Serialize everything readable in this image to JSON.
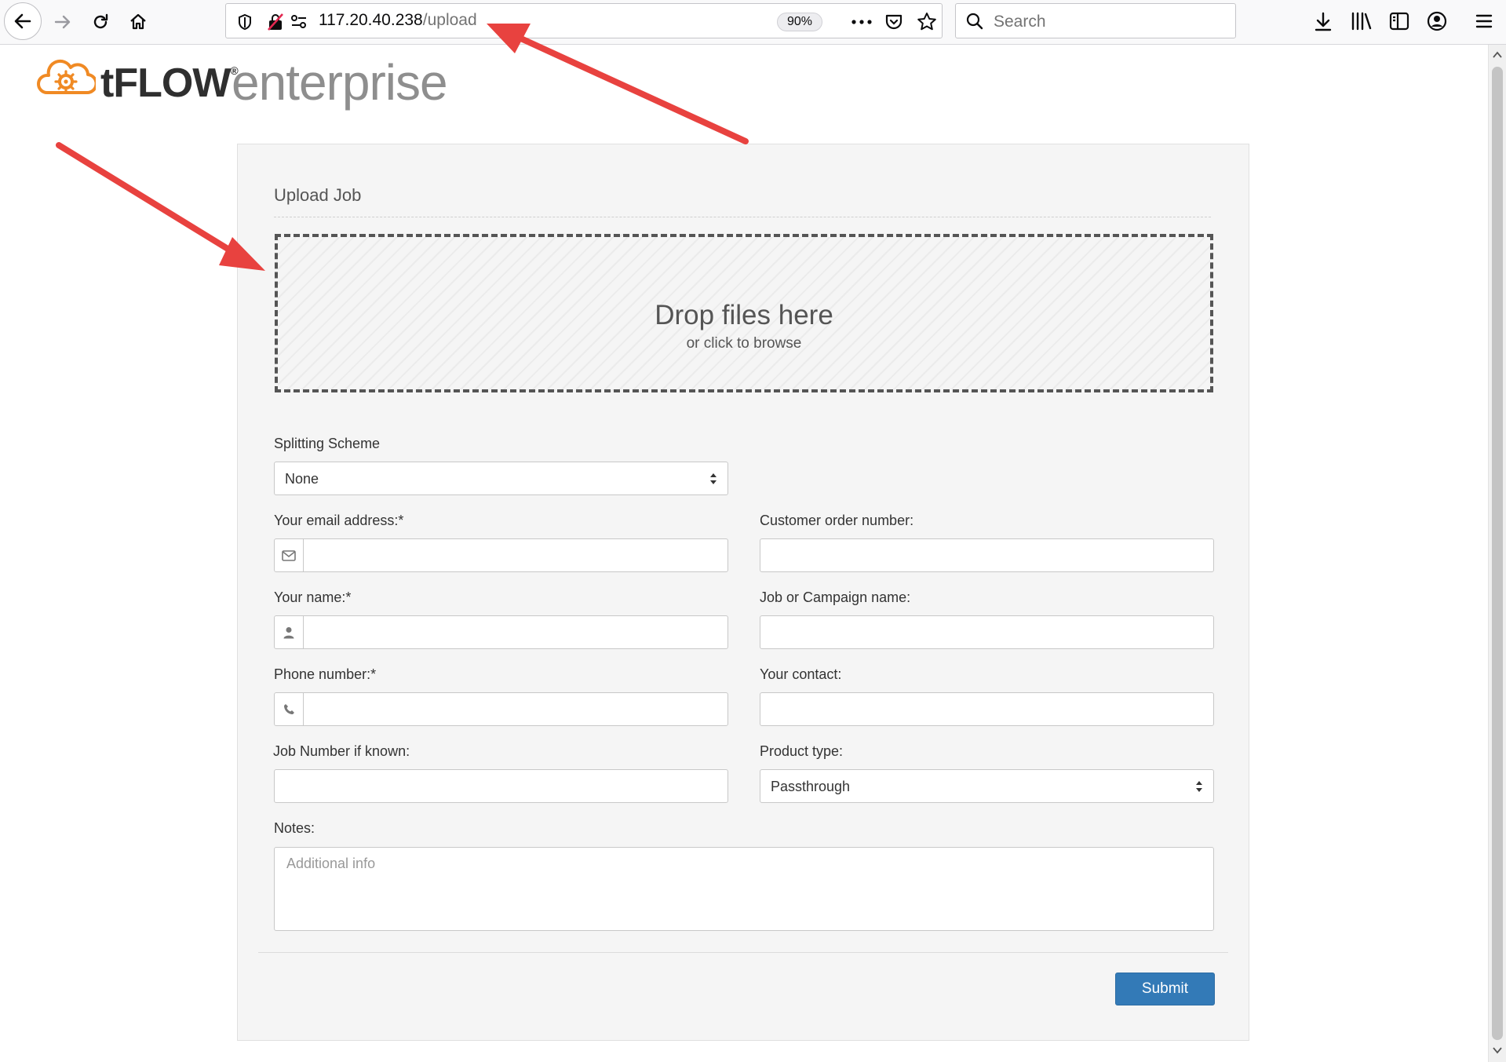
{
  "browser": {
    "url_host": "117.20.40.238",
    "url_path": "/upload",
    "zoom": "90%",
    "search_placeholder": "Search"
  },
  "brand": {
    "logo_name": "tFLOW",
    "logo_reg": "®",
    "product": "enterprise",
    "accent_color": "#f08a24"
  },
  "form": {
    "title": "Upload Job",
    "dropzone": {
      "title": "Drop files here",
      "subtitle": "or click to browse"
    },
    "splitting": {
      "label": "Splitting Scheme",
      "value": "None"
    },
    "email": {
      "label": "Your email address:*",
      "value": ""
    },
    "name": {
      "label": "Your name:*",
      "value": ""
    },
    "phone": {
      "label": "Phone number:*",
      "value": ""
    },
    "job_number": {
      "label": "Job Number if known:",
      "value": ""
    },
    "customer_order": {
      "label": "Customer order number:",
      "value": ""
    },
    "campaign": {
      "label": "Job or Campaign name:",
      "value": ""
    },
    "contact": {
      "label": "Your contact:",
      "value": ""
    },
    "product_type": {
      "label": "Product type:",
      "value": "Passthrough"
    },
    "notes": {
      "label": "Notes:",
      "placeholder": "Additional info"
    },
    "submit_label": "Submit",
    "primary_color": "#337ab7"
  },
  "annotations": {
    "arrow_color": "#e8423f"
  }
}
